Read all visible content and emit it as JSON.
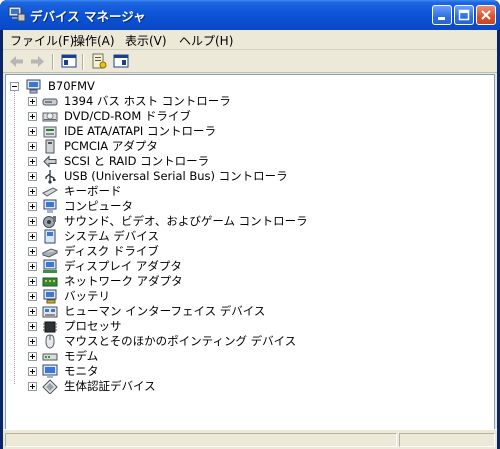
{
  "window": {
    "title": "デバイス マネージャ"
  },
  "menu": [
    {
      "label": "ファイル(F)"
    },
    {
      "label": "操作(A)"
    },
    {
      "label": "表示(V)"
    },
    {
      "label": "ヘルプ(H)"
    }
  ],
  "tree": {
    "root": "B70FMV",
    "items": [
      {
        "label": "1394 バス ホスト コントローラ",
        "icon": "firewire-controller-icon"
      },
      {
        "label": "DVD/CD-ROM ドライブ",
        "icon": "cdrom-drive-icon"
      },
      {
        "label": "IDE ATA/ATAPI コントローラ",
        "icon": "ide-controller-icon"
      },
      {
        "label": "PCMCIA アダプタ",
        "icon": "pcmcia-adapter-icon"
      },
      {
        "label": "SCSI と RAID コントローラ",
        "icon": "scsi-controller-icon"
      },
      {
        "label": "USB (Universal Serial Bus) コントローラ",
        "icon": "usb-controller-icon"
      },
      {
        "label": "キーボード",
        "icon": "keyboard-icon"
      },
      {
        "label": "コンピュータ",
        "icon": "computer-icon"
      },
      {
        "label": "サウンド、ビデオ、およびゲーム コントローラ",
        "icon": "sound-video-game-icon"
      },
      {
        "label": "システム デバイス",
        "icon": "system-device-icon"
      },
      {
        "label": "ディスク ドライブ",
        "icon": "disk-drive-icon"
      },
      {
        "label": "ディスプレイ アダプタ",
        "icon": "display-adapter-icon"
      },
      {
        "label": "ネットワーク アダプタ",
        "icon": "network-adapter-icon"
      },
      {
        "label": "バッテリ",
        "icon": "battery-icon"
      },
      {
        "label": "ヒューマン インターフェイス デバイス",
        "icon": "hid-icon"
      },
      {
        "label": "プロセッサ",
        "icon": "processor-icon"
      },
      {
        "label": "マウスとそのほかのポインティング デバイス",
        "icon": "mouse-icon"
      },
      {
        "label": "モデム",
        "icon": "modem-icon"
      },
      {
        "label": "モニタ",
        "icon": "monitor-icon"
      },
      {
        "label": "生体認証デバイス",
        "icon": "biometric-device-icon"
      }
    ]
  },
  "colors": {
    "titlebar": "#0b56d7",
    "chrome": "#ece9d8",
    "close": "#d8532e"
  }
}
